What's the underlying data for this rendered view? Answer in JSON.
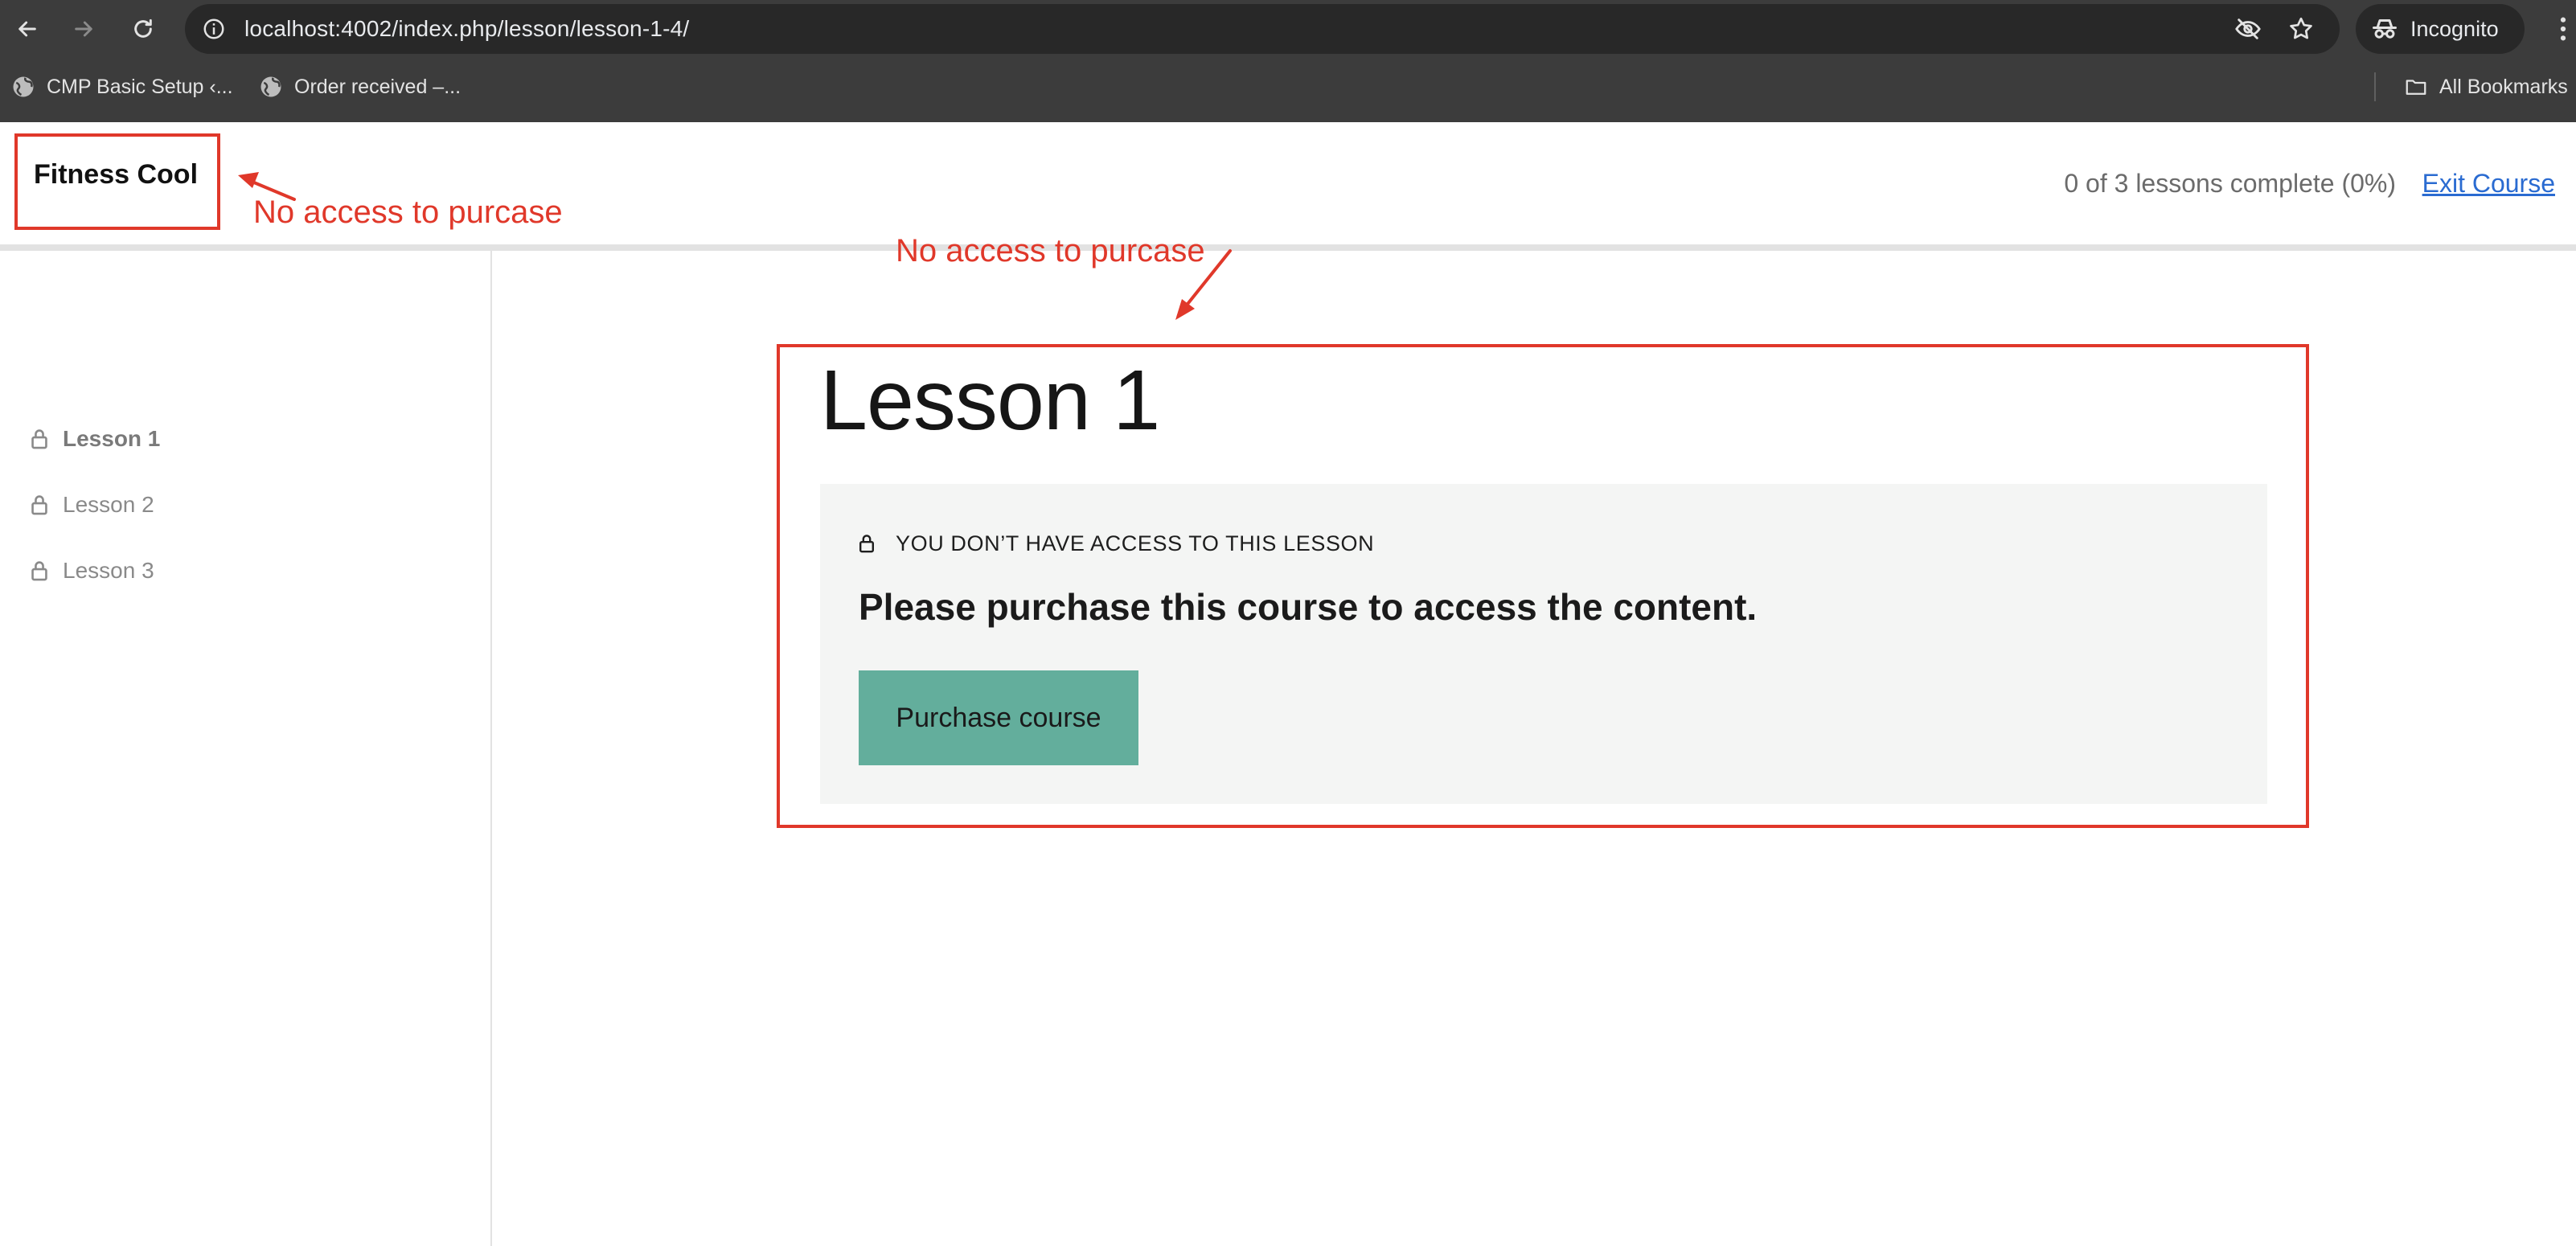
{
  "browser": {
    "url": "localhost:4002/index.php/lesson/lesson-1-4/",
    "incognito_label": "Incognito",
    "bookmarks": [
      {
        "label": "CMP Basic Setup ‹..."
      },
      {
        "label": "Order received –..."
      }
    ],
    "all_bookmarks_label": "All Bookmarks"
  },
  "header": {
    "brand": "Fitness Cool",
    "progress": "0 of 3 lessons complete (0%)",
    "exit_label": "Exit Course"
  },
  "sidebar": {
    "lessons": [
      {
        "label": "Lesson 1",
        "active": true,
        "locked": true
      },
      {
        "label": "Lesson 2",
        "active": false,
        "locked": true
      },
      {
        "label": "Lesson 3",
        "active": false,
        "locked": true
      }
    ]
  },
  "lesson": {
    "title": "Lesson 1",
    "notice": "YOU DON’T HAVE ACCESS TO THIS LESSON",
    "message": "Please purchase this course to access the content.",
    "purchase_label": "Purchase course"
  },
  "annotations": [
    {
      "text": "No access to purcase"
    },
    {
      "text": "No access to purcase"
    }
  ],
  "colors": {
    "annotation": "#e0382a",
    "purchase_button": "#63ae9c",
    "link": "#2a6bd1"
  }
}
